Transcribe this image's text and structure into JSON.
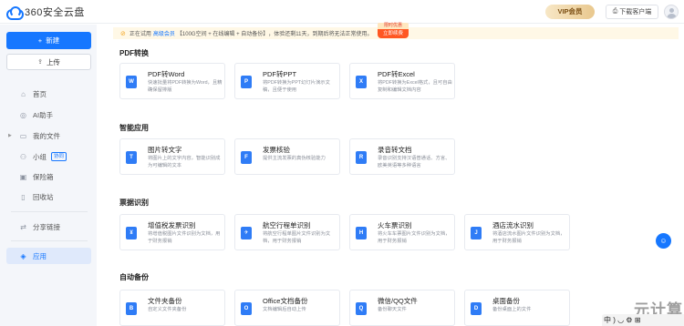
{
  "header": {
    "logo_text": "360安全云盘",
    "vip_label": "VIP会员",
    "download_label": "下载客户端"
  },
  "sidebar": {
    "new_label": "新建",
    "upload_label": "上传",
    "items": [
      {
        "label": "首页",
        "icon": "home-icon"
      },
      {
        "label": "AI助手",
        "icon": "ai-icon"
      },
      {
        "label": "我的文件",
        "icon": "folder-icon"
      },
      {
        "label": "小组",
        "icon": "group-icon",
        "tag": "协同"
      },
      {
        "label": "保险箱",
        "icon": "safe-icon"
      },
      {
        "label": "回收站",
        "icon": "trash-icon"
      },
      {
        "label": "分享链接",
        "icon": "share-icon"
      },
      {
        "label": "应用",
        "icon": "apps-icon"
      }
    ]
  },
  "notice": {
    "prefix": "正在试用",
    "link": "高级会员",
    "features": "【100G空间 + 在线编辑 + 自动备份】",
    "suffix": "，体验还剩11天，到期后将无法正常使用。",
    "badge_top": "限时优惠",
    "badge_bottom": "立即续费"
  },
  "sections": [
    {
      "title": "PDF转换",
      "cards": [
        {
          "title": "PDF转Word",
          "desc": "快速批量将PDF转换为Word，且精确保留排版",
          "icon": "W"
        },
        {
          "title": "PDF转PPT",
          "desc": "将PDF转换为PPT幻灯片演示文稿，且便于使用",
          "icon": "P"
        },
        {
          "title": "PDF转Excel",
          "desc": "将PDF转换为Excel格式，且可自由复制和编辑文档内容",
          "icon": "X"
        }
      ]
    },
    {
      "title": "智能应用",
      "cards": [
        {
          "title": "图片转文字",
          "desc": "将图片上的文字内容，智能识别成为可编辑的文本",
          "icon": "T"
        },
        {
          "title": "发票核验",
          "desc": "提供主流发票的真伪核验能力",
          "icon": "F"
        },
        {
          "title": "录音转文档",
          "desc": "录音识别支持汉语普通话、方言、欧美英语等多种语言",
          "icon": "R"
        }
      ]
    },
    {
      "title": "票据识别",
      "cards": [
        {
          "title": "增值税发票识别",
          "desc": "将增值税图片文件识别为文档，用于财务报销",
          "icon": "¥"
        },
        {
          "title": "航空行程单识别",
          "desc": "将航空行程单图片文件识别为文档，用于财务报销",
          "icon": "✈"
        },
        {
          "title": "火车票识别",
          "desc": "将火车车票图片文件识别为文档，用于财务报销",
          "icon": "H"
        },
        {
          "title": "酒店流水识别",
          "desc": "将酒店流水图片文件识别为文档，用于财务报销",
          "icon": "J"
        }
      ]
    },
    {
      "title": "自动备份",
      "cards": [
        {
          "title": "文件夹备份",
          "desc": "自定义文件夹备份",
          "icon": "B"
        },
        {
          "title": "Office文档备份",
          "desc": "文档编辑后自动上传",
          "icon": "O"
        },
        {
          "title": "微信/QQ文件",
          "desc": "备份聊天文件",
          "icon": "Q"
        },
        {
          "title": "桌面备份",
          "desc": "备份桌面上的文件",
          "icon": "D"
        }
      ]
    }
  ],
  "ime": {
    "text": "中 ) ◡ ⚙ ⊞"
  },
  "watermark": "元计算",
  "colors": {
    "accent": "#1677ff",
    "notice_bg": "#fff8e6"
  }
}
